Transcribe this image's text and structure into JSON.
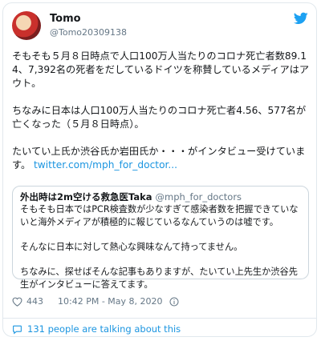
{
  "user": {
    "name": "Tomo",
    "handle": "@Tomo20309138"
  },
  "tweet": {
    "text": "そもそも５月８日時点で人口100万人当たりのコロナ死亡者数89.14、7,392名の死者をだしているドイツを称賛しているメディアはアウト。\n\nちなみに日本は人口100万人当たりのコロナ死亡者4.56、577名が亡くなった（５月８日時点）。\n\nたいてい上氏か渋谷氏か岩田氏か・・・がインタビュー受けています。",
    "link": "twitter.com/mph_for_doctor..."
  },
  "quote": {
    "name": "外出時は2m空ける救急医Taka",
    "handle": "@mph_for_doctors",
    "text": "そもそも日本ではPCR検査数が少なすぎて感染者数を把握できていないと海外メディアが積極的に報じているなんていうのは嘘です。\n\nそんなに日本に対して熱心な興味なんて持ってません。\n\nちなみに、探せばそんな記事もありますが、たいてい上先生か渋谷先生がインタビューに答えてます。"
  },
  "meta": {
    "likes": "443",
    "timestamp": "10:42 PM - May 8, 2020"
  },
  "talk": {
    "label": "131 people are talking about this"
  },
  "icons": {
    "bird": "twitter-bird-icon",
    "heart": "heart-icon",
    "info": "info-icon",
    "talk": "comment-icon"
  },
  "colors": {
    "brand": "#1da1f2",
    "link": "#1b95e0",
    "muted": "#657786",
    "heart": "#e0245e"
  }
}
